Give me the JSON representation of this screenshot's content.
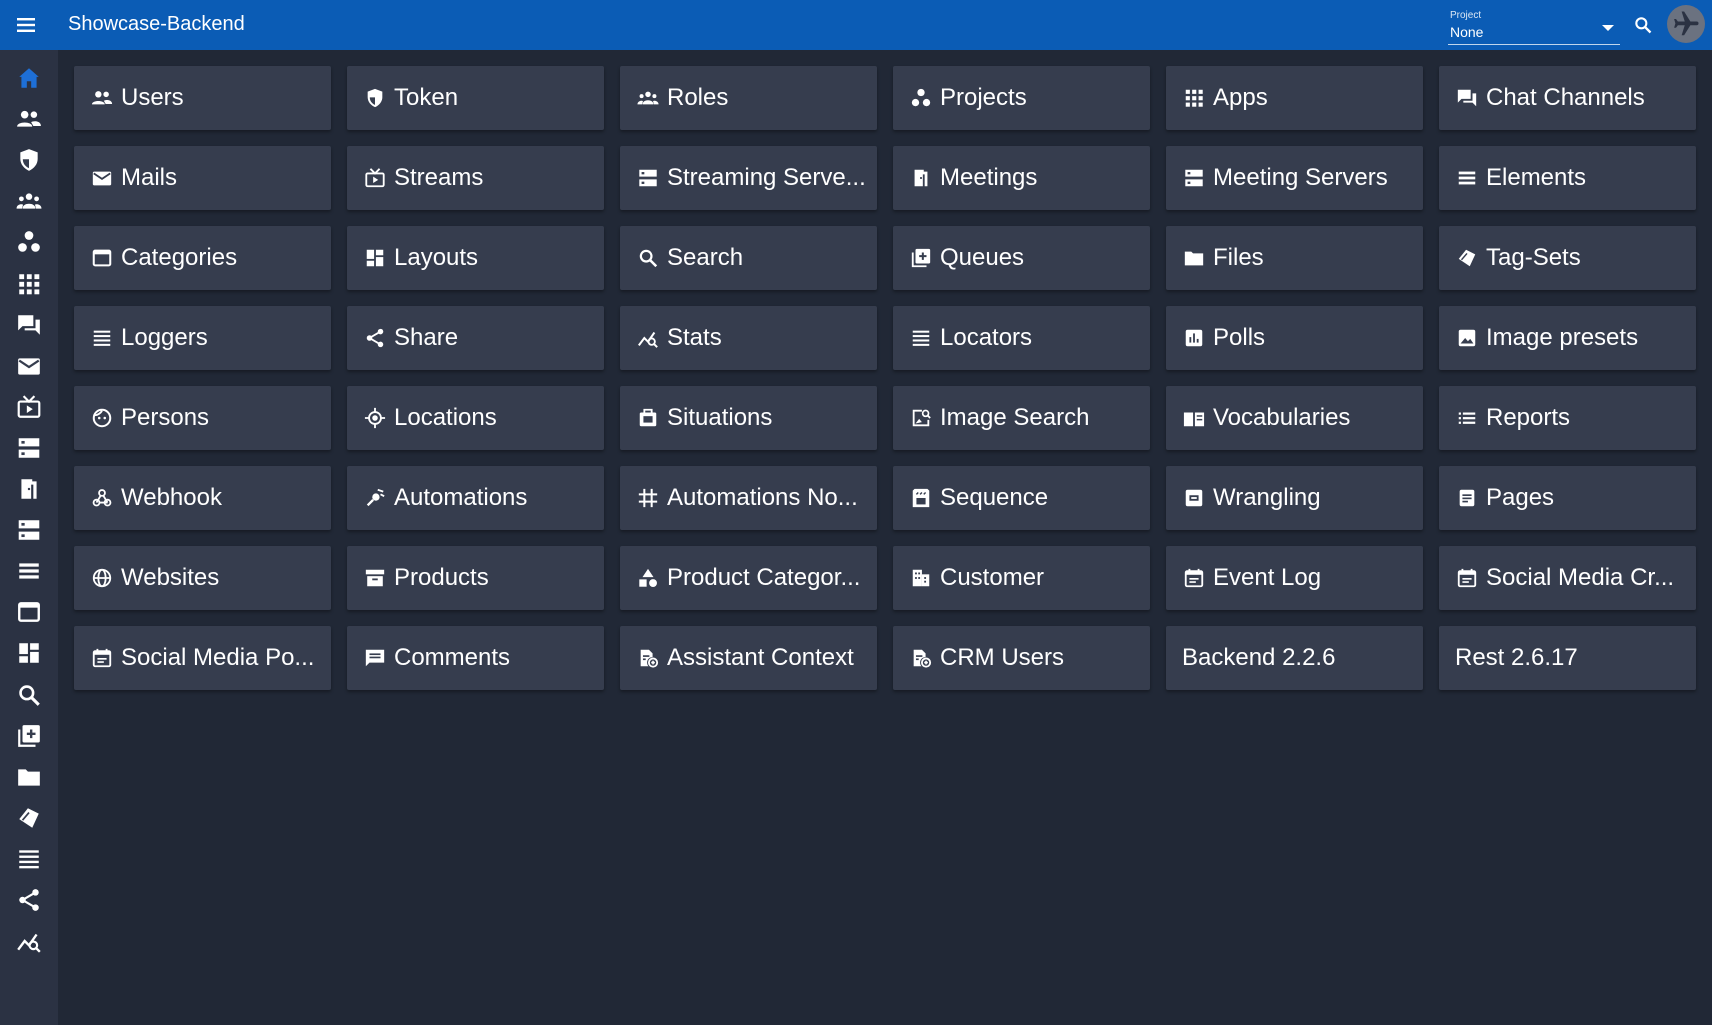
{
  "header": {
    "title": "Showcase-Backend",
    "project_label": "Project",
    "project_value": "None"
  },
  "colors": {
    "header_bg": "#0b5cb5",
    "sidebar_bg": "#2b3243",
    "page_bg": "#212836",
    "tile_bg": "#363d4e",
    "active_icon": "#1e6fd6",
    "icon": "#ffffff"
  },
  "sidebar": {
    "items": [
      {
        "icon": "home-icon",
        "active": true
      },
      {
        "icon": "users-icon"
      },
      {
        "icon": "shield-icon"
      },
      {
        "icon": "roles-icon"
      },
      {
        "icon": "projects-icon"
      },
      {
        "icon": "apps-icon"
      },
      {
        "icon": "chat-icon"
      },
      {
        "icon": "mail-icon"
      },
      {
        "icon": "stream-icon"
      },
      {
        "icon": "server-icon"
      },
      {
        "icon": "meeting-icon"
      },
      {
        "icon": "server-icon"
      },
      {
        "icon": "list-icon"
      },
      {
        "icon": "window-icon"
      },
      {
        "icon": "dashboard-icon"
      },
      {
        "icon": "search-icon"
      },
      {
        "icon": "queue-icon"
      },
      {
        "icon": "folder-icon"
      },
      {
        "icon": "tag-icon"
      },
      {
        "icon": "lines-icon"
      },
      {
        "icon": "share-icon"
      },
      {
        "icon": "stats-icon"
      }
    ]
  },
  "tiles": [
    {
      "label": "Users",
      "icon": "users-icon"
    },
    {
      "label": "Token",
      "icon": "shield-icon"
    },
    {
      "label": "Roles",
      "icon": "roles-icon"
    },
    {
      "label": "Projects",
      "icon": "projects-icon"
    },
    {
      "label": "Apps",
      "icon": "apps-icon"
    },
    {
      "label": "Chat Channels",
      "icon": "chat-icon"
    },
    {
      "label": "Mails",
      "icon": "mail-icon"
    },
    {
      "label": "Streams",
      "icon": "stream-icon"
    },
    {
      "label": "Streaming Serve...",
      "icon": "server-icon"
    },
    {
      "label": "Meetings",
      "icon": "meeting-icon"
    },
    {
      "label": "Meeting Servers",
      "icon": "server-icon"
    },
    {
      "label": "Elements",
      "icon": "list-icon"
    },
    {
      "label": "Categories",
      "icon": "window-icon"
    },
    {
      "label": "Layouts",
      "icon": "dashboard-icon"
    },
    {
      "label": "Search",
      "icon": "search-icon"
    },
    {
      "label": "Queues",
      "icon": "queue-icon"
    },
    {
      "label": "Files",
      "icon": "folder-icon"
    },
    {
      "label": "Tag-Sets",
      "icon": "tag-icon"
    },
    {
      "label": "Loggers",
      "icon": "lines-icon"
    },
    {
      "label": "Share",
      "icon": "share-icon"
    },
    {
      "label": "Stats",
      "icon": "stats-icon"
    },
    {
      "label": "Locators",
      "icon": "lines-icon"
    },
    {
      "label": "Polls",
      "icon": "poll-icon"
    },
    {
      "label": "Image presets",
      "icon": "image-icon"
    },
    {
      "label": "Persons",
      "icon": "face-icon"
    },
    {
      "label": "Locations",
      "icon": "location-icon"
    },
    {
      "label": "Situations",
      "icon": "situation-icon"
    },
    {
      "label": "Image Search",
      "icon": "image-search-icon"
    },
    {
      "label": "Vocabularies",
      "icon": "book-icon"
    },
    {
      "label": "Reports",
      "icon": "bullet-list-icon"
    },
    {
      "label": "Webhook",
      "icon": "webhook-icon"
    },
    {
      "label": "Automations",
      "icon": "automation-icon"
    },
    {
      "label": "Automations No...",
      "icon": "grid-icon"
    },
    {
      "label": "Sequence",
      "icon": "sequence-icon"
    },
    {
      "label": "Wrangling",
      "icon": "wrangling-icon"
    },
    {
      "label": "Pages",
      "icon": "page-icon"
    },
    {
      "label": "Websites",
      "icon": "globe-icon"
    },
    {
      "label": "Products",
      "icon": "archive-icon"
    },
    {
      "label": "Product Categor...",
      "icon": "category-icon"
    },
    {
      "label": "Customer",
      "icon": "building-icon"
    },
    {
      "label": "Event Log",
      "icon": "calendar-icon"
    },
    {
      "label": "Social Media Cr...",
      "icon": "calendar-icon"
    },
    {
      "label": "Social Media Po...",
      "icon": "calendar-icon"
    },
    {
      "label": "Comments",
      "icon": "comment-icon"
    },
    {
      "label": "Assistant Context",
      "icon": "context-icon"
    },
    {
      "label": "CRM Users",
      "icon": "context-icon"
    },
    {
      "label": "Backend 2.2.6",
      "icon": ""
    },
    {
      "label": "Rest 2.6.17",
      "icon": ""
    }
  ]
}
